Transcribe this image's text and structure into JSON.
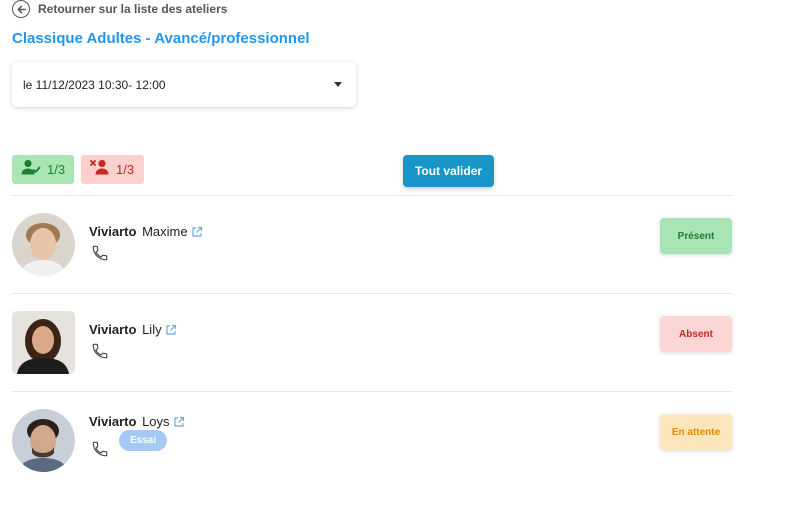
{
  "back": {
    "label": "Retourner sur la liste des ateliers"
  },
  "page": {
    "title": "Classique Adultes - Avancé/professionnel"
  },
  "session_select": {
    "value": "le 11/12/2023 10:30- 12:00"
  },
  "counts": {
    "present": "1/3",
    "absent": "1/3"
  },
  "actions": {
    "validate_all": "Tout valider"
  },
  "participants": [
    {
      "lastname": "Viviarto",
      "firstname": "Maxime",
      "status": "Présent",
      "tag": ""
    },
    {
      "lastname": "Viviarto",
      "firstname": "Lily",
      "status": "Absent",
      "tag": ""
    },
    {
      "lastname": "Viviarto",
      "firstname": "Loys",
      "status": "En attente",
      "tag": "Essai"
    }
  ],
  "colors": {
    "accent": "#2196f3",
    "button": "#1796c7",
    "present": "#a9e4b7",
    "absent": "#fcd6d4",
    "waiting": "#fde5bc"
  }
}
